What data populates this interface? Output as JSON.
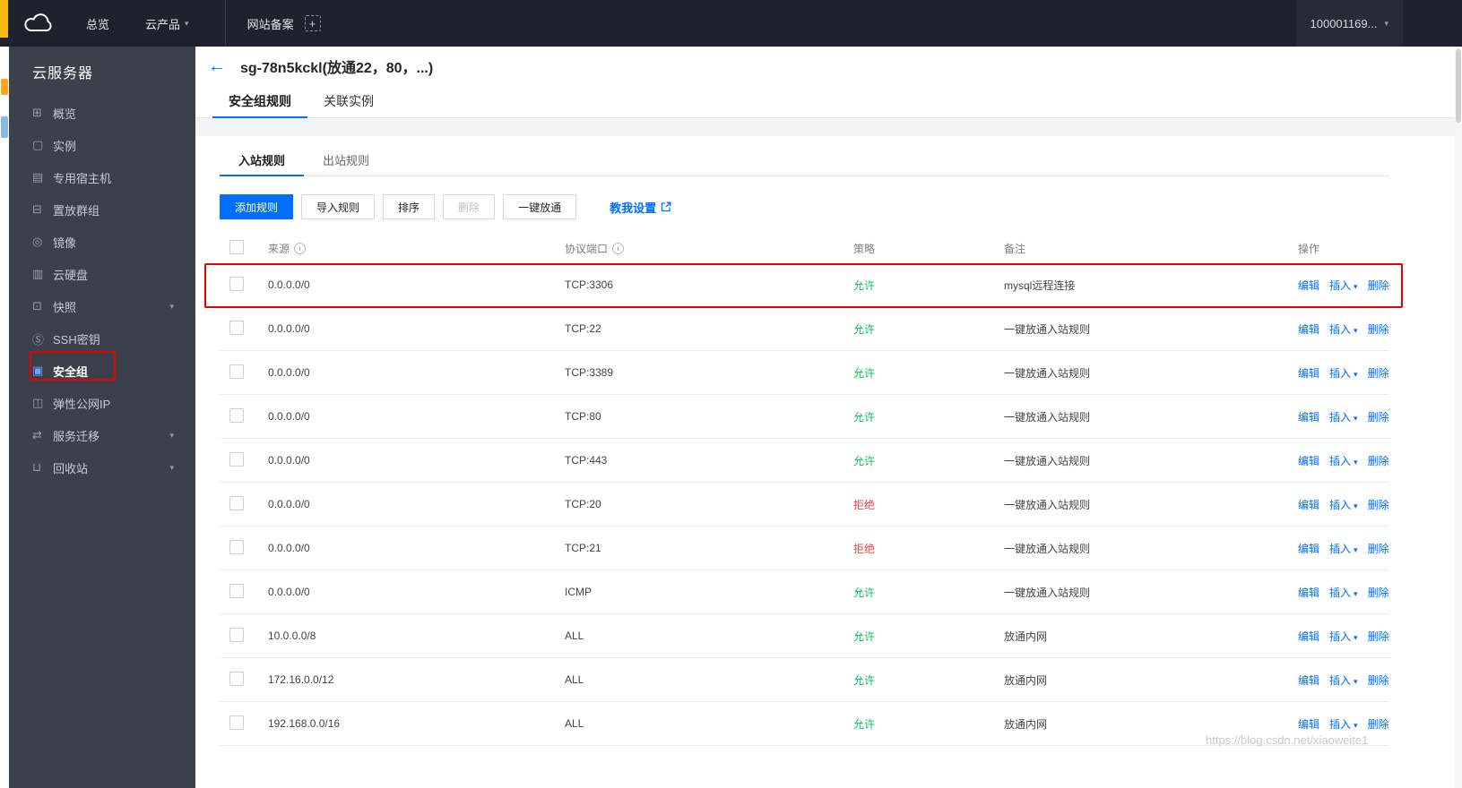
{
  "icons": {
    "back_arrow": "←",
    "caret_down": "▾",
    "info": "i",
    "plus": "+"
  },
  "topbar": {
    "nav": [
      {
        "label": "总览",
        "caret": ""
      },
      {
        "label": "云产品",
        "caret": "▾"
      }
    ],
    "pinned_tab": "网站备案",
    "account": "100001169...",
    "account_caret": "▾"
  },
  "sidebar": {
    "title": "云服务器",
    "items": [
      {
        "label": "概览",
        "glyph": "⊞",
        "caret": ""
      },
      {
        "label": "实例",
        "glyph": "▢",
        "caret": ""
      },
      {
        "label": "专用宿主机",
        "glyph": "▤",
        "caret": ""
      },
      {
        "label": "置放群组",
        "glyph": "⊟",
        "caret": ""
      },
      {
        "label": "镜像",
        "glyph": "◎",
        "caret": ""
      },
      {
        "label": "云硬盘",
        "glyph": "▥",
        "caret": ""
      },
      {
        "label": "快照",
        "glyph": "⊡",
        "caret": "▾"
      },
      {
        "label": "SSH密钥",
        "glyph": "Ⓢ",
        "caret": ""
      },
      {
        "label": "安全组",
        "glyph": "▣",
        "caret": ""
      },
      {
        "label": "弹性公网IP",
        "glyph": "◫",
        "caret": ""
      },
      {
        "label": "服务迁移",
        "glyph": "⇄",
        "caret": "▾"
      },
      {
        "label": "回收站",
        "glyph": "⊔",
        "caret": "▾"
      }
    ]
  },
  "page": {
    "title": "sg-78n5kckl(放通22，80，...)",
    "tabs": [
      {
        "label": "安全组规则"
      },
      {
        "label": "关联实例"
      }
    ],
    "inner_tabs": [
      {
        "label": "入站规则"
      },
      {
        "label": "出站规则"
      }
    ],
    "toolbar": {
      "add": "添加规则",
      "import": "导入规则",
      "sort": "排序",
      "delete": "删除",
      "open_all": "一键放通",
      "help": "教我设置"
    }
  },
  "table": {
    "headers": {
      "source": "来源",
      "port": "协议端口",
      "policy": "策略",
      "note": "备注",
      "ops": "操作"
    },
    "actions": {
      "edit": "编辑",
      "insert": "插入",
      "del": "删除"
    },
    "rows": [
      {
        "source": "0.0.0.0/0",
        "port": "TCP:3306",
        "policy": "允许",
        "policy_class": "policy-allow",
        "note": "mysql远程连接"
      },
      {
        "source": "0.0.0.0/0",
        "port": "TCP:22",
        "policy": "允许",
        "policy_class": "policy-allow",
        "note": "一键放通入站规则"
      },
      {
        "source": "0.0.0.0/0",
        "port": "TCP:3389",
        "policy": "允许",
        "policy_class": "policy-allow",
        "note": "一键放通入站规则"
      },
      {
        "source": "0.0.0.0/0",
        "port": "TCP:80",
        "policy": "允许",
        "policy_class": "policy-allow",
        "note": "一键放通入站规则"
      },
      {
        "source": "0.0.0.0/0",
        "port": "TCP:443",
        "policy": "允许",
        "policy_class": "policy-allow",
        "note": "一键放通入站规则"
      },
      {
        "source": "0.0.0.0/0",
        "port": "TCP:20",
        "policy": "拒绝",
        "policy_class": "policy-deny",
        "note": "一键放通入站规则"
      },
      {
        "source": "0.0.0.0/0",
        "port": "TCP:21",
        "policy": "拒绝",
        "policy_class": "policy-deny",
        "note": "一键放通入站规则"
      },
      {
        "source": "0.0.0.0/0",
        "port": "ICMP",
        "policy": "允许",
        "policy_class": "policy-allow",
        "note": "一键放通入站规则"
      },
      {
        "source": "10.0.0.0/8",
        "port": "ALL",
        "policy": "允许",
        "policy_class": "policy-allow",
        "note": "放通内网"
      },
      {
        "source": "172.16.0.0/12",
        "port": "ALL",
        "policy": "允许",
        "policy_class": "policy-allow",
        "note": "放通内网"
      },
      {
        "source": "192.168.0.0/16",
        "port": "ALL",
        "policy": "允许",
        "policy_class": "policy-allow",
        "note": "放通内网"
      }
    ]
  },
  "colors": {
    "accent": "#006eff",
    "allow": "#0abf5b",
    "deny": "#e54545",
    "annotation": "#e80000"
  },
  "watermark": "https://blog.csdn.net/xiaoweite1"
}
